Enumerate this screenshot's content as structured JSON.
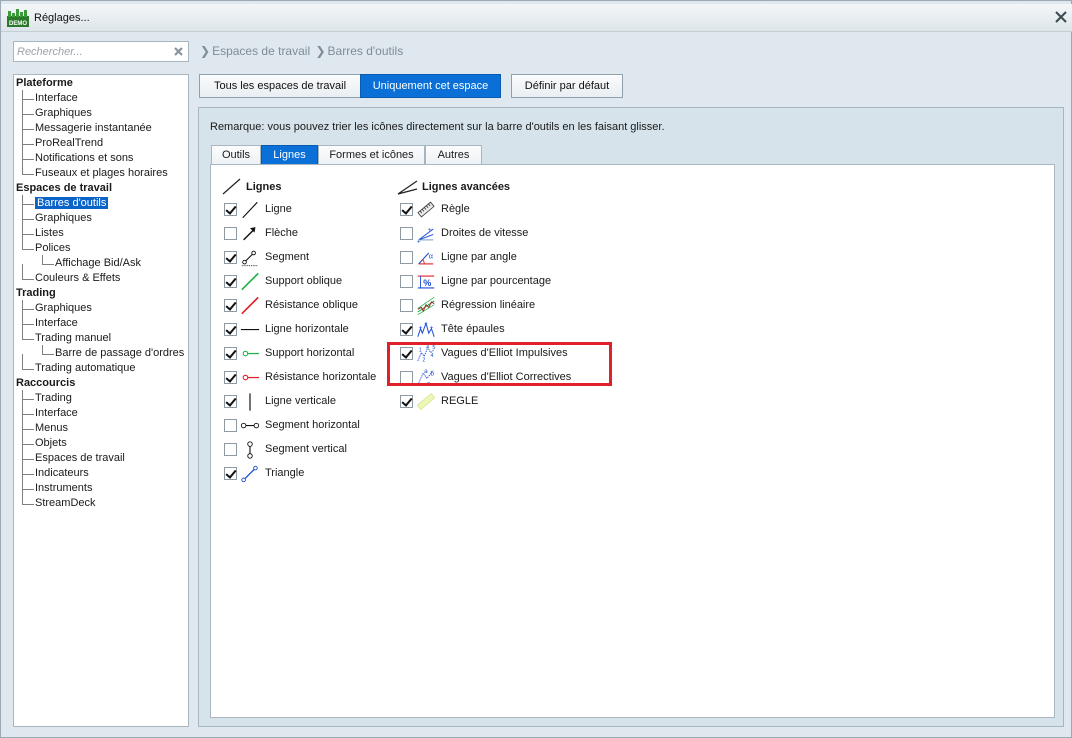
{
  "window": {
    "title": "Réglages..."
  },
  "search": {
    "placeholder": "Rechercher..."
  },
  "breadcrumb": [
    "Espaces de travail",
    "Barres d'outils"
  ],
  "tree": [
    {
      "label": "Plateforme",
      "level": 0
    },
    {
      "label": "Interface",
      "level": 1
    },
    {
      "label": "Graphiques",
      "level": 1
    },
    {
      "label": "Messagerie instantanée",
      "level": 1
    },
    {
      "label": "ProRealTrend",
      "level": 1
    },
    {
      "label": "Notifications et sons",
      "level": 1
    },
    {
      "label": "Fuseaux et plages horaires",
      "level": 1
    },
    {
      "label": "Espaces de travail",
      "level": 0
    },
    {
      "label": "Barres d'outils",
      "level": 1,
      "selected": true
    },
    {
      "label": "Graphiques",
      "level": 1
    },
    {
      "label": "Listes",
      "level": 1
    },
    {
      "label": "Polices",
      "level": 1
    },
    {
      "label": "Affichage Bid/Ask",
      "level": 2
    },
    {
      "label": "Couleurs & Effets",
      "level": 1
    },
    {
      "label": "Trading",
      "level": 0
    },
    {
      "label": "Graphiques",
      "level": 1
    },
    {
      "label": "Interface",
      "level": 1
    },
    {
      "label": "Trading manuel",
      "level": 1
    },
    {
      "label": "Barre de passage d'ordres",
      "level": 2
    },
    {
      "label": "Trading automatique",
      "level": 1
    },
    {
      "label": "Raccourcis",
      "level": 0
    },
    {
      "label": "Trading",
      "level": 1
    },
    {
      "label": "Interface",
      "level": 1
    },
    {
      "label": "Menus",
      "level": 1
    },
    {
      "label": "Objets",
      "level": 1
    },
    {
      "label": "Espaces de travail",
      "level": 1
    },
    {
      "label": "Indicateurs",
      "level": 1
    },
    {
      "label": "Instruments",
      "level": 1
    },
    {
      "label": "StreamDeck",
      "level": 1
    }
  ],
  "scope_buttons": {
    "all": "Tous les espaces de travail",
    "this": "Uniquement cet espace",
    "default": "Définir par défaut"
  },
  "remark": "Remarque: vous pouvez trier les icônes directement sur la barre d'outils en les faisant glisser.",
  "tabs": [
    "Outils",
    "Lignes",
    "Formes et icônes",
    "Autres"
  ],
  "active_tab": "Lignes",
  "lines_column": {
    "title": "Lignes",
    "items": [
      {
        "label": "Ligne",
        "checked": true,
        "icon": "line-icon"
      },
      {
        "label": "Flèche",
        "checked": false,
        "icon": "arrow-icon"
      },
      {
        "label": "Segment",
        "checked": true,
        "icon": "segment-icon"
      },
      {
        "label": "Support oblique",
        "checked": true,
        "icon": "oblique-support-icon"
      },
      {
        "label": "Résistance oblique",
        "checked": true,
        "icon": "oblique-resistance-icon"
      },
      {
        "label": "Ligne horizontale",
        "checked": true,
        "icon": "horizontal-line-icon"
      },
      {
        "label": "Support horizontal",
        "checked": true,
        "icon": "horizontal-support-icon"
      },
      {
        "label": "Résistance horizontale",
        "checked": true,
        "icon": "horizontal-resistance-icon"
      },
      {
        "label": "Ligne verticale",
        "checked": true,
        "icon": "vertical-line-icon"
      },
      {
        "label": "Segment horizontal",
        "checked": false,
        "icon": "horizontal-segment-icon"
      },
      {
        "label": "Segment vertical",
        "checked": false,
        "icon": "vertical-segment-icon"
      },
      {
        "label": "Triangle",
        "checked": true,
        "icon": "triangle-icon"
      }
    ]
  },
  "advanced_column": {
    "title": "Lignes avancées",
    "items": [
      {
        "label": "Règle",
        "checked": true,
        "icon": "ruler-icon"
      },
      {
        "label": "Droites de vitesse",
        "checked": false,
        "icon": "speed-lines-icon"
      },
      {
        "label": "Ligne par angle",
        "checked": false,
        "icon": "angle-line-icon"
      },
      {
        "label": "Ligne par pourcentage",
        "checked": false,
        "icon": "percentage-line-icon",
        "icon_text": "%"
      },
      {
        "label": "Régression linéaire",
        "checked": false,
        "icon": "linear-regression-icon"
      },
      {
        "label": "Tête épaules",
        "checked": true,
        "icon": "head-shoulders-icon"
      },
      {
        "label": "Vagues d'Elliot Impulsives",
        "checked": true,
        "icon": "elliott-impulse-icon",
        "icon_text": "1 3 5 2 4"
      },
      {
        "label": "Vagues d'Elliot Correctives",
        "checked": false,
        "icon": "elliott-corrective-icon",
        "icon_text": "a b c"
      },
      {
        "label": "REGLE",
        "checked": true,
        "icon": "ruler-highlight-icon"
      }
    ]
  },
  "colors": {
    "accent": "#0a6fd6",
    "highlight_box": "#e0202a",
    "support": "#22b14c",
    "resistance": "#e0202a",
    "tool_blue": "#1f4fd1"
  }
}
